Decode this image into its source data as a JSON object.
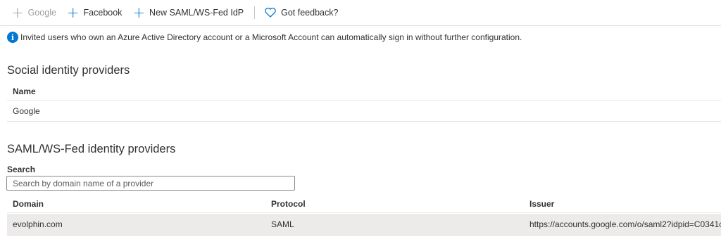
{
  "toolbar": {
    "google_label": "Google",
    "facebook_label": "Facebook",
    "new_saml_label": "New SAML/WS-Fed IdP",
    "feedback_label": "Got feedback?",
    "accent": "#0078d4"
  },
  "info_message": "Invited users who own an Azure Active Directory account or a Microsoft Account can automatically sign in without further configuration.",
  "social": {
    "title": "Social identity providers",
    "columns": [
      "Name"
    ],
    "rows": [
      [
        "Google"
      ]
    ]
  },
  "saml": {
    "title": "SAML/WS-Fed identity providers",
    "search_label": "Search",
    "search_placeholder": "Search by domain name of a provider",
    "columns": [
      "Domain",
      "Protocol",
      "Issuer"
    ],
    "rows": [
      [
        "evolphin.com",
        "SAML",
        "https://accounts.google.com/o/saml2?idpid=C0341c"
      ]
    ]
  }
}
